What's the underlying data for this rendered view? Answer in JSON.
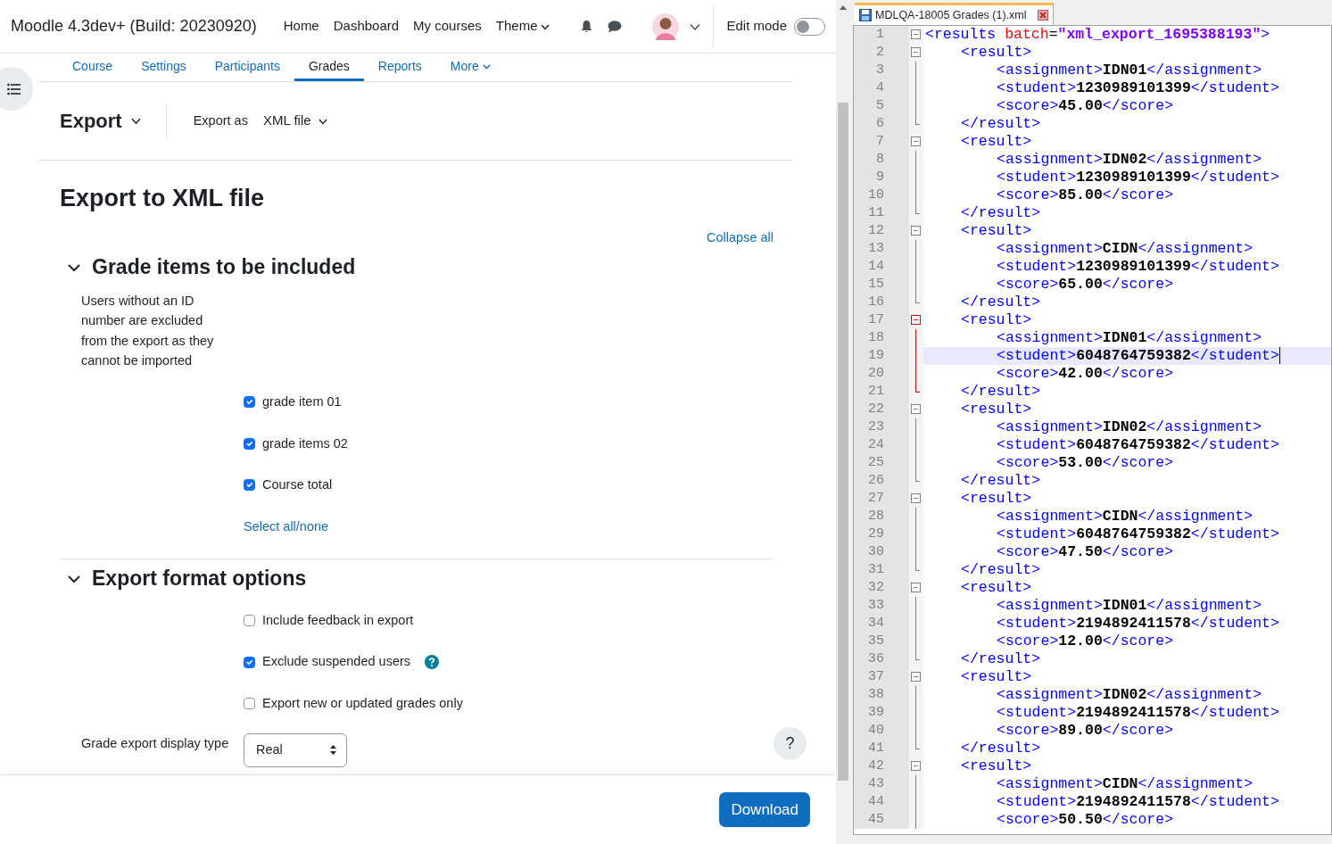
{
  "navbar": {
    "brand": "Moodle 4.3dev+ (Build: 20230920)",
    "links": [
      {
        "label": "Home",
        "dropdown": false
      },
      {
        "label": "Dashboard",
        "dropdown": false
      },
      {
        "label": "My courses",
        "dropdown": false
      },
      {
        "label": "Theme",
        "dropdown": true
      }
    ],
    "edit_mode": {
      "label": "Edit mode",
      "on": false
    }
  },
  "course_tabs": [
    {
      "label": "Course",
      "selected": false,
      "dropdown": false
    },
    {
      "label": "Settings",
      "selected": false,
      "dropdown": false
    },
    {
      "label": "Participants",
      "selected": false,
      "dropdown": false
    },
    {
      "label": "Grades",
      "selected": true,
      "dropdown": false
    },
    {
      "label": "Reports",
      "selected": false,
      "dropdown": false
    },
    {
      "label": "More",
      "selected": false,
      "dropdown": true
    }
  ],
  "tertiary": {
    "action": "Export",
    "export_as_label": "Export as",
    "export_as_value": "XML file"
  },
  "page_title": "Export to XML file",
  "collapse_all": "Collapse all",
  "sections": [
    {
      "title": "Grade items to be included",
      "expanded": true,
      "description": "Users without an ID number are excluded from the export as they cannot be imported",
      "checkboxes": [
        {
          "label": "grade item 01",
          "checked": true,
          "help": false
        },
        {
          "label": "grade items 02",
          "checked": true,
          "help": false
        },
        {
          "label": "Course total",
          "checked": true,
          "help": false
        }
      ],
      "select_all": "Select all/none"
    },
    {
      "title": "Export format options",
      "expanded": true,
      "checkboxes": [
        {
          "label": "Include feedback in export",
          "checked": false,
          "help": false
        },
        {
          "label": "Exclude suspended users",
          "checked": true,
          "help": true
        },
        {
          "label": "Export new or updated grades only",
          "checked": false,
          "help": false
        }
      ],
      "select": {
        "label": "Grade export display type",
        "value": "Real"
      }
    }
  ],
  "help_button": "?",
  "download_button": "Download",
  "editor": {
    "tab": "MDLQA-18005 Grades (1).xml",
    "root": {
      "line": "1",
      "open": "<results",
      "attr": "batch",
      "eq": "=",
      "value": "\"xml_export_1695388193\"",
      "end": ">"
    },
    "results": [
      {
        "line": "2",
        "open": "<result>",
        "active": false,
        "close_line": "6",
        "close": "</result>",
        "fields": [
          {
            "line": "3",
            "open": "<assignment>",
            "value": "IDN01",
            "close": "</assignment>",
            "current": false
          },
          {
            "line": "4",
            "open": "<student>",
            "value": "1230989101399",
            "close": "</student>",
            "current": false
          },
          {
            "line": "5",
            "open": "<score>",
            "value": "45.00",
            "close": "</score>",
            "current": false
          }
        ]
      },
      {
        "line": "7",
        "open": "<result>",
        "active": false,
        "close_line": "11",
        "close": "</result>",
        "fields": [
          {
            "line": "8",
            "open": "<assignment>",
            "value": "IDN02",
            "close": "</assignment>",
            "current": false
          },
          {
            "line": "9",
            "open": "<student>",
            "value": "1230989101399",
            "close": "</student>",
            "current": false
          },
          {
            "line": "10",
            "open": "<score>",
            "value": "85.00",
            "close": "</score>",
            "current": false
          }
        ]
      },
      {
        "line": "12",
        "open": "<result>",
        "active": false,
        "close_line": "16",
        "close": "</result>",
        "fields": [
          {
            "line": "13",
            "open": "<assignment>",
            "value": "CIDN",
            "close": "</assignment>",
            "current": false
          },
          {
            "line": "14",
            "open": "<student>",
            "value": "1230989101399",
            "close": "</student>",
            "current": false
          },
          {
            "line": "15",
            "open": "<score>",
            "value": "65.00",
            "close": "</score>",
            "current": false
          }
        ]
      },
      {
        "line": "17",
        "open": "<result>",
        "active": true,
        "close_line": "21",
        "close": "</result>",
        "fields": [
          {
            "line": "18",
            "open": "<assignment>",
            "value": "IDN01",
            "close": "</assignment>",
            "current": false
          },
          {
            "line": "19",
            "open": "<student>",
            "value": "6048764759382",
            "close": "</student>",
            "current": true
          },
          {
            "line": "20",
            "open": "<score>",
            "value": "42.00",
            "close": "</score>",
            "current": false
          }
        ]
      },
      {
        "line": "22",
        "open": "<result>",
        "active": false,
        "close_line": "26",
        "close": "</result>",
        "fields": [
          {
            "line": "23",
            "open": "<assignment>",
            "value": "IDN02",
            "close": "</assignment>",
            "current": false
          },
          {
            "line": "24",
            "open": "<student>",
            "value": "6048764759382",
            "close": "</student>",
            "current": false
          },
          {
            "line": "25",
            "open": "<score>",
            "value": "53.00",
            "close": "</score>",
            "current": false
          }
        ]
      },
      {
        "line": "27",
        "open": "<result>",
        "active": false,
        "close_line": "31",
        "close": "</result>",
        "fields": [
          {
            "line": "28",
            "open": "<assignment>",
            "value": "CIDN",
            "close": "</assignment>",
            "current": false
          },
          {
            "line": "29",
            "open": "<student>",
            "value": "6048764759382",
            "close": "</student>",
            "current": false
          },
          {
            "line": "30",
            "open": "<score>",
            "value": "47.50",
            "close": "</score>",
            "current": false
          }
        ]
      },
      {
        "line": "32",
        "open": "<result>",
        "active": false,
        "close_line": "36",
        "close": "</result>",
        "fields": [
          {
            "line": "33",
            "open": "<assignment>",
            "value": "IDN01",
            "close": "</assignment>",
            "current": false
          },
          {
            "line": "34",
            "open": "<student>",
            "value": "2194892411578",
            "close": "</student>",
            "current": false
          },
          {
            "line": "35",
            "open": "<score>",
            "value": "12.00",
            "close": "</score>",
            "current": false
          }
        ]
      },
      {
        "line": "37",
        "open": "<result>",
        "active": false,
        "close_line": "41",
        "close": "</result>",
        "fields": [
          {
            "line": "38",
            "open": "<assignment>",
            "value": "IDN02",
            "close": "</assignment>",
            "current": false
          },
          {
            "line": "39",
            "open": "<student>",
            "value": "2194892411578",
            "close": "</student>",
            "current": false
          },
          {
            "line": "40",
            "open": "<score>",
            "value": "89.00",
            "close": "</score>",
            "current": false
          }
        ]
      },
      {
        "line": "42",
        "open": "<result>",
        "active": false,
        "fields": [
          {
            "line": "43",
            "open": "<assignment>",
            "value": "CIDN",
            "close": "</assignment>",
            "current": false
          },
          {
            "line": "44",
            "open": "<student>",
            "value": "2194892411578",
            "close": "</student>",
            "current": false
          },
          {
            "line": "45",
            "open": "<score>",
            "value": "50.50",
            "close": "</score>",
            "current": false
          }
        ]
      }
    ]
  }
}
